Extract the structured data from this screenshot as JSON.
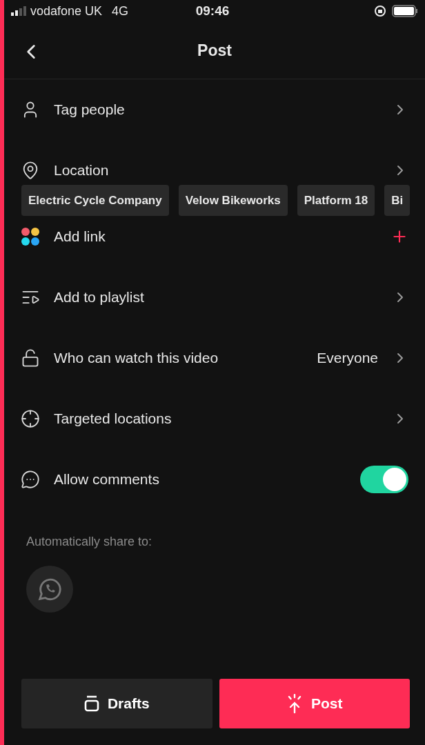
{
  "status_bar": {
    "carrier": "vodafone UK",
    "network": "4G",
    "time": "09:46"
  },
  "header": {
    "title": "Post"
  },
  "rows": [
    {
      "label": "Tag people",
      "kind": "chevron"
    },
    {
      "label": "Location",
      "kind": "chevron",
      "chips": [
        "Electric Cycle Company",
        "Velow Bikeworks",
        "Platform 18",
        "Bi"
      ]
    },
    {
      "label": "Add link",
      "kind": "plus"
    },
    {
      "label": "Add to playlist",
      "kind": "chevron"
    },
    {
      "label": "Who can watch this video",
      "kind": "chevron",
      "value": "Everyone"
    },
    {
      "label": "Targeted locations",
      "kind": "chevron"
    },
    {
      "label": "Allow comments",
      "kind": "toggle",
      "on": true
    }
  ],
  "share": {
    "label": "Automatically share to:"
  },
  "buttons": [
    {
      "label": "Drafts",
      "kind": "secondary"
    },
    {
      "label": "Post",
      "kind": "primary"
    }
  ]
}
